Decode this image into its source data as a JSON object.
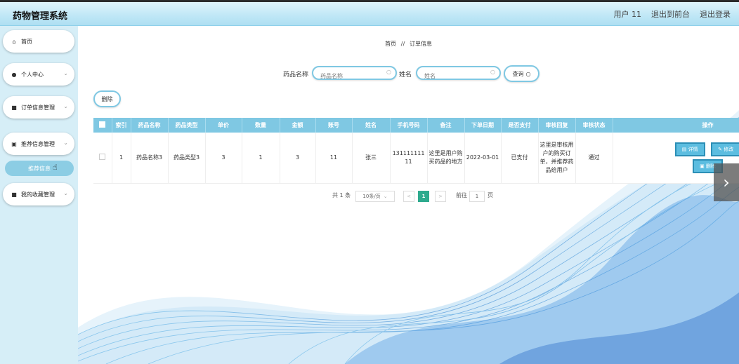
{
  "app": {
    "title": "药物管理系统"
  },
  "header": {
    "links": [
      "用户 11",
      "退出到前台",
      "退出登录"
    ]
  },
  "sidebar": {
    "items": [
      {
        "icon": "home-icon",
        "glyph": "⌂",
        "label": "首页",
        "has_chevron": false
      },
      {
        "icon": "user-icon",
        "glyph": "●",
        "label": "个人中心",
        "has_chevron": true
      },
      {
        "icon": "grid-icon",
        "glyph": "■",
        "label": "订单信息管理",
        "has_chevron": true
      },
      {
        "icon": "clipboard-icon",
        "glyph": "▣",
        "label": "推荐信息管理",
        "has_chevron": true
      },
      {
        "icon": "grid-icon",
        "glyph": "■",
        "label": "我的收藏管理",
        "has_chevron": true
      }
    ],
    "active_sub": "推荐信息",
    "chevron": "⌄"
  },
  "breadcrumb": {
    "home": "首页",
    "sep": "//",
    "current": "订单信息"
  },
  "search": {
    "field1_label": "药品名称",
    "field1_placeholder": "药品名称",
    "field2_label": "姓名",
    "field2_placeholder": "姓名",
    "query_label": "查询",
    "search_glyph": "○"
  },
  "toolbar": {
    "delete_label": "删除"
  },
  "table": {
    "headers": [
      "索引",
      "药品名称",
      "药品类型",
      "单价",
      "数量",
      "金额",
      "账号",
      "姓名",
      "手机号码",
      "备注",
      "下单日期",
      "是否支付",
      "审核回复",
      "审核状态",
      "操作"
    ],
    "rows": [
      [
        "1",
        "药品名称3",
        "药品类型3",
        "3",
        "1",
        "3",
        "11",
        "张三",
        "13111111111",
        "这里是用户购买药品的地方",
        "2022-03-01",
        "已支付",
        "这里是审核用户的购买订单，并推荐药品给用户",
        "通过"
      ]
    ],
    "actions": {
      "detail": "详情",
      "edit": "修改",
      "delete": "删除"
    }
  },
  "pager": {
    "total": "共 1 条",
    "page_size": "10条/页",
    "current_page": "1",
    "goto_prefix": "前往",
    "goto_value": "1",
    "goto_suffix": "页",
    "prev": "<",
    "next": ">"
  },
  "colors": {
    "accent": "#7fc8e3",
    "header_bg": "#bfe7f6",
    "sidebar_bg": "#d6eef7",
    "page_active": "#2eaa8e"
  }
}
